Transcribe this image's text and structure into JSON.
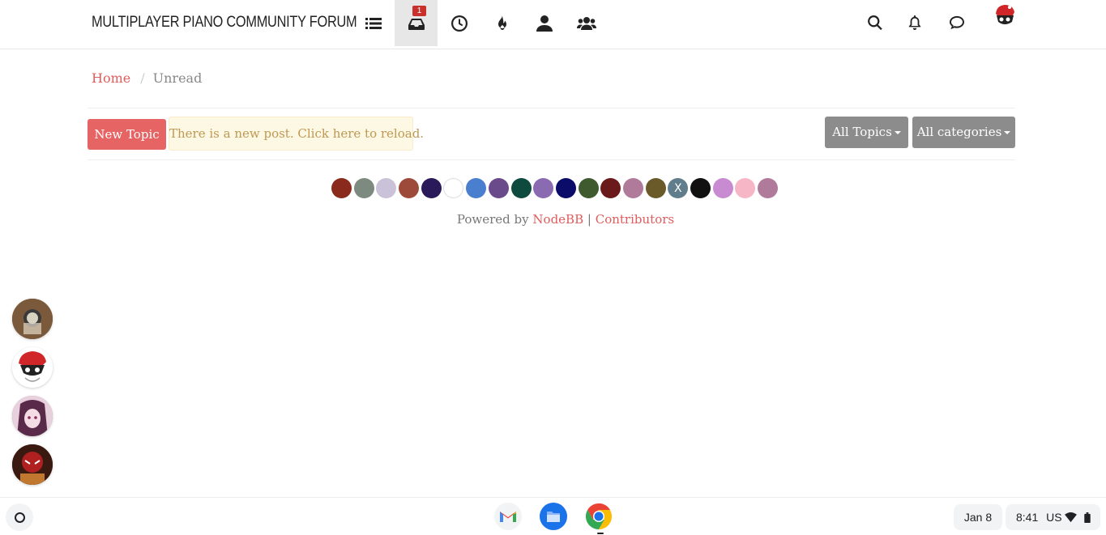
{
  "navbar": {
    "brand": "MULTIPLAYER PIANO COMMUNITY FORUM",
    "items": [
      {
        "name": "categories",
        "icon": "list-icon"
      },
      {
        "name": "unread",
        "icon": "inbox-icon",
        "badge": "1",
        "active": true
      },
      {
        "name": "recent",
        "icon": "clock-icon"
      },
      {
        "name": "popular",
        "icon": "fire-icon"
      },
      {
        "name": "users",
        "icon": "user-icon"
      },
      {
        "name": "groups",
        "icon": "users-icon"
      }
    ],
    "right": [
      {
        "name": "search",
        "icon": "search-icon"
      },
      {
        "name": "notifications",
        "icon": "bell-icon"
      },
      {
        "name": "chats",
        "icon": "comment-icon"
      }
    ]
  },
  "breadcrumb": {
    "home": "Home",
    "separator": "/",
    "current": "Unread"
  },
  "toolbar": {
    "new_topic": "New Topic",
    "new_post_alert": "There is a new post. Click here to reload.",
    "filter_topics": "All Topics",
    "filter_categories": "All categories"
  },
  "contributors": {
    "avatars": [
      "#8a2a1c",
      "#7d8a80",
      "#c9c2d8",
      "#9e4a3a",
      "#2a1a5a",
      "#ffffff",
      "#4a7fd0",
      "#6a4a8a",
      "#0e4a3e",
      "#8a6ab0",
      "#0b0b6a",
      "#3e5a2e",
      "#6a1a1a",
      "#b07a9a",
      "#6a5a2a",
      "#607d8b",
      "#111111",
      "#c88ad0",
      "#f7b6c6",
      "#b07a9a"
    ],
    "letter_avatar": "X",
    "powered_by": "Powered by",
    "nodebb": "NodeBB",
    "pipe": "|",
    "contributors_link": "Contributors"
  },
  "chat_avatars": [
    "#7a5a3a",
    "#ffffff",
    "#a86a8a",
    "#5a1a1a"
  ],
  "shelf": {
    "apps": [
      "gmail-icon",
      "files-icon",
      "chrome-icon"
    ],
    "date": "Jan 8",
    "time": "8:41",
    "locale": "US"
  },
  "colors": {
    "accent": "#e76464",
    "link": "#e05c5c",
    "alert_bg": "#fcf8e3",
    "filter_btn": "#8c8c8c"
  }
}
